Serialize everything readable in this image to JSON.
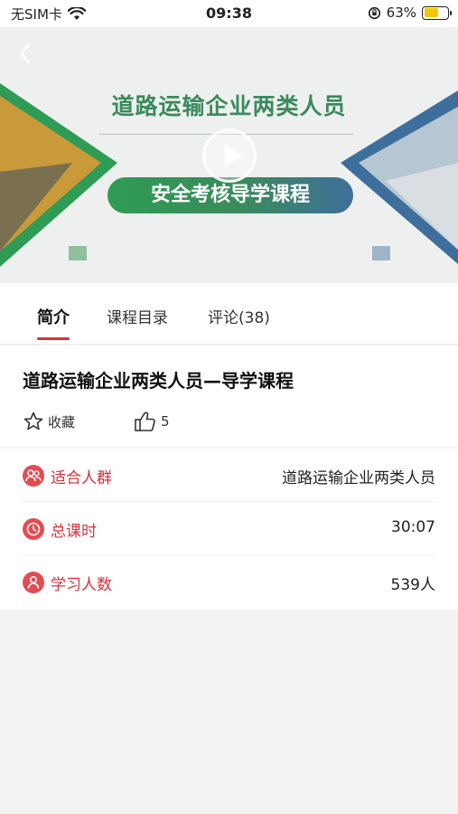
{
  "status_bar": {
    "carrier": "无SIM卡",
    "time": "09:38",
    "battery": "63%"
  },
  "banner": {
    "title": "道路运输企业两类人员",
    "subtitle": "安全考核导学课程"
  },
  "tabs": [
    {
      "label": "简介",
      "active": true
    },
    {
      "label": "课程目录",
      "active": false
    },
    {
      "label": "评论(38)",
      "active": false
    }
  ],
  "course": {
    "title": "道路运输企业两类人员—导学课程",
    "favorite_label": "收藏",
    "likes": "5"
  },
  "info": [
    {
      "label": "适合人群",
      "value": "道路运输企业两类人员",
      "icon": "people-icon"
    },
    {
      "label": "总课时",
      "value": "30:07",
      "icon": "clock-icon"
    },
    {
      "label": "学习人数",
      "value": "539人",
      "icon": "user-icon"
    }
  ],
  "colors": {
    "accent": "#d9303a",
    "banner_green": "#3b8a5c",
    "banner_blue": "#3e6f9c"
  }
}
